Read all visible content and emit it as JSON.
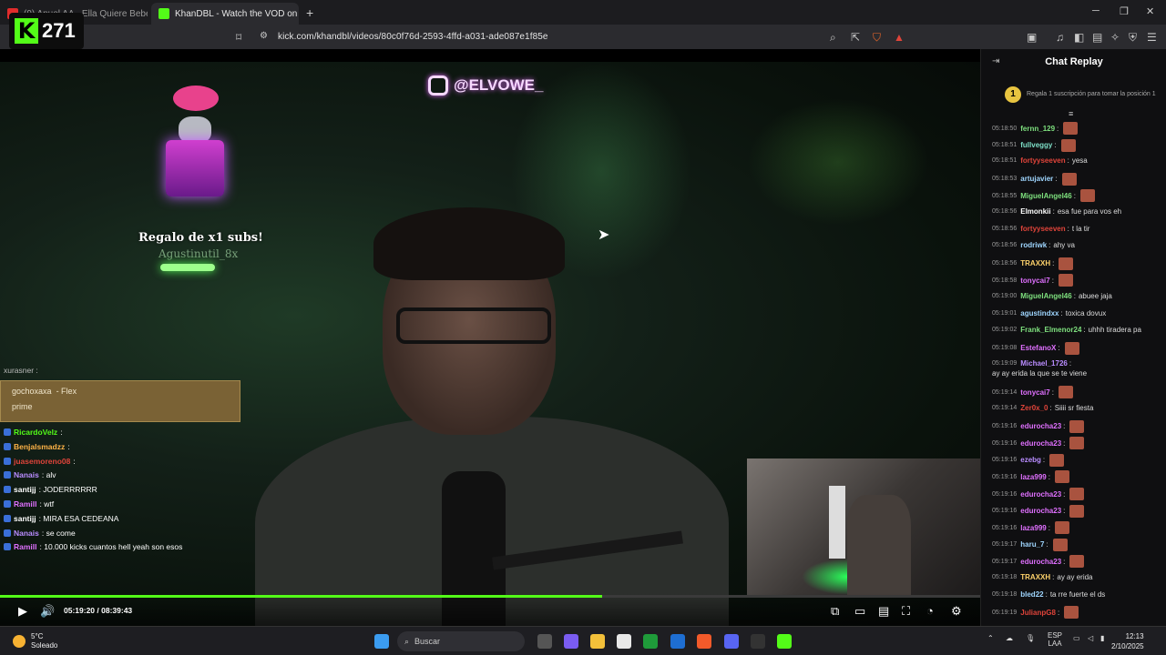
{
  "browser": {
    "tabs": [
      {
        "label": "(9) Anuel AA - Ella Quiere Beber (Vidéo",
        "active": false
      },
      {
        "label": "KhanDBL - Watch the VOD on Ki",
        "active": true
      }
    ],
    "url": "kick.com/khandbl/videos/80c0f76d-2593-4ffd-a031-ade087e1f85e",
    "badge_count_1": "2",
    "badge_count_2": "4"
  },
  "kick_badge": {
    "logo": "K",
    "count": "271"
  },
  "video": {
    "instagram_handle": "@ELVOWE_",
    "gift_title": "Regalo de x1 subs!",
    "gift_user": "Agustinutil_8x",
    "overlay_chat": {
      "top_line": "xurasner :",
      "flex": {
        "user": "gochoxaxa",
        "tag": "- Flex",
        "message": "prime"
      },
      "lines": [
        {
          "user": "RicardoVelz",
          "text": ":",
          "color": "#53fc18"
        },
        {
          "user": "Benjalsmadzz",
          "text": ":",
          "color": "#ffb347"
        },
        {
          "user": "juasemoreno08",
          "text": ":",
          "color": "#e0443a"
        },
        {
          "user": "Nanais",
          "text": ": alv",
          "color": "#b98cff"
        },
        {
          "user": "santijj",
          "text": ": JODERRRRRR",
          "color": "#ffffff"
        },
        {
          "user": "Ramill",
          "text": ": wtf",
          "color": "#e070ff"
        },
        {
          "user": "santijj",
          "text": ": MIRA ESA CEDEANA",
          "color": "#ffffff"
        },
        {
          "user": "Nanais",
          "text": ": se come",
          "color": "#b98cff"
        },
        {
          "user": "Ramill",
          "text": ": 10.000 kicks cuantos hell yeah son esos",
          "color": "#e070ff"
        }
      ]
    },
    "time_current": "05:19:20",
    "time_total": "08:39:43",
    "progress": 0.614
  },
  "chat": {
    "title": "Chat Replay",
    "promo": "Regala 1 suscripción para tomar la posición 1",
    "promo_rank": "1",
    "messages": [
      {
        "ts": "05:18:50",
        "user": "fernn_129",
        "text": "",
        "color": "#7ee07e",
        "emote": true
      },
      {
        "ts": "05:18:51",
        "user": "fullveggy",
        "text": "",
        "color": "#7ee0c8",
        "emote": true
      },
      {
        "ts": "05:18:51",
        "user": "fortyyseeven",
        "text": "yesa",
        "color": "#e0443a",
        "emote": false
      },
      {
        "ts": "05:18:53",
        "user": "artujavier",
        "text": "",
        "color": "#9fd6ff",
        "emote": true
      },
      {
        "ts": "05:18:55",
        "user": "MiguelAngel46",
        "text": "",
        "color": "#7ee07e",
        "emote": true
      },
      {
        "ts": "05:18:56",
        "user": "Elmonkii",
        "text": "esa fue para vos eh",
        "color": "#ffffff",
        "emote": false
      },
      {
        "ts": "05:18:56",
        "user": "fortyyseeven",
        "text": "t la tir",
        "color": "#e0443a",
        "emote": false
      },
      {
        "ts": "05:18:56",
        "user": "rodriwk",
        "text": "ahy va",
        "color": "#9fd6ff",
        "emote": false
      },
      {
        "ts": "05:18:56",
        "user": "TRAXXH",
        "text": "",
        "color": "#ffd36b",
        "emote": true
      },
      {
        "ts": "05:18:58",
        "user": "tonycai7",
        "text": "",
        "color": "#e070ff",
        "emote": true
      },
      {
        "ts": "05:19:00",
        "user": "MiguelAngel46",
        "text": "abuee jaja",
        "color": "#7ee07e",
        "emote": false
      },
      {
        "ts": "05:19:01",
        "user": "agustindxx",
        "text": "toxica dovux",
        "color": "#9fd6ff",
        "emote": false
      },
      {
        "ts": "05:19:02",
        "user": "Frank_Elmenor24",
        "text": "uhhh tiradera pa",
        "color": "#7ee07e",
        "emote": false
      },
      {
        "ts": "05:19:08",
        "user": "EstefanoX",
        "text": "",
        "color": "#e070ff",
        "emote": true
      },
      {
        "ts": "05:19:09",
        "user": "Michael_1726",
        "text": "ay ay erida la que se te viene",
        "color": "#b98cff",
        "emote": false
      },
      {
        "ts": "05:19:14",
        "user": "tonycai7",
        "text": "",
        "color": "#e070ff",
        "emote": true
      },
      {
        "ts": "05:19:14",
        "user": "Zer0x_0",
        "text": "Siiii sr fiesta",
        "color": "#e0443a",
        "emote": false
      },
      {
        "ts": "05:19:16",
        "user": "edurocha23",
        "text": "",
        "color": "#e070ff",
        "emote": true
      },
      {
        "ts": "05:19:16",
        "user": "edurocha23",
        "text": "",
        "color": "#e070ff",
        "emote": true
      },
      {
        "ts": "05:19:16",
        "user": "ezebg",
        "text": "",
        "color": "#b98cff",
        "emote": true
      },
      {
        "ts": "05:19:16",
        "user": "laza999",
        "text": "",
        "color": "#e070ff",
        "emote": true
      },
      {
        "ts": "05:19:16",
        "user": "edurocha23",
        "text": "",
        "color": "#e070ff",
        "emote": true
      },
      {
        "ts": "05:19:16",
        "user": "edurocha23",
        "text": "",
        "color": "#e070ff",
        "emote": true
      },
      {
        "ts": "05:19:16",
        "user": "laza999",
        "text": "",
        "color": "#e070ff",
        "emote": true
      },
      {
        "ts": "05:19:17",
        "user": "haru_7",
        "text": "",
        "color": "#9fd6ff",
        "emote": true
      },
      {
        "ts": "05:19:17",
        "user": "edurocha23",
        "text": "",
        "color": "#e070ff",
        "emote": true
      },
      {
        "ts": "05:19:18",
        "user": "TRAXXH",
        "text": "ay ay erida",
        "color": "#ffd36b",
        "emote": false
      },
      {
        "ts": "05:19:18",
        "user": "bled22",
        "text": "ta rre fuerte el ds",
        "color": "#9fd6ff",
        "emote": false
      },
      {
        "ts": "05:19:19",
        "user": "JulianpG8",
        "text": "",
        "color": "#e0443a",
        "emote": true
      }
    ]
  },
  "taskbar": {
    "temp": "5°C",
    "weather": "Soleado",
    "search": "Buscar",
    "lang": "ESP",
    "lang2": "LAA",
    "time": "12:13",
    "date": "2/10/2025"
  },
  "colors": {
    "kick_green": "#53fc18",
    "flex_bg": "#7a6235"
  }
}
